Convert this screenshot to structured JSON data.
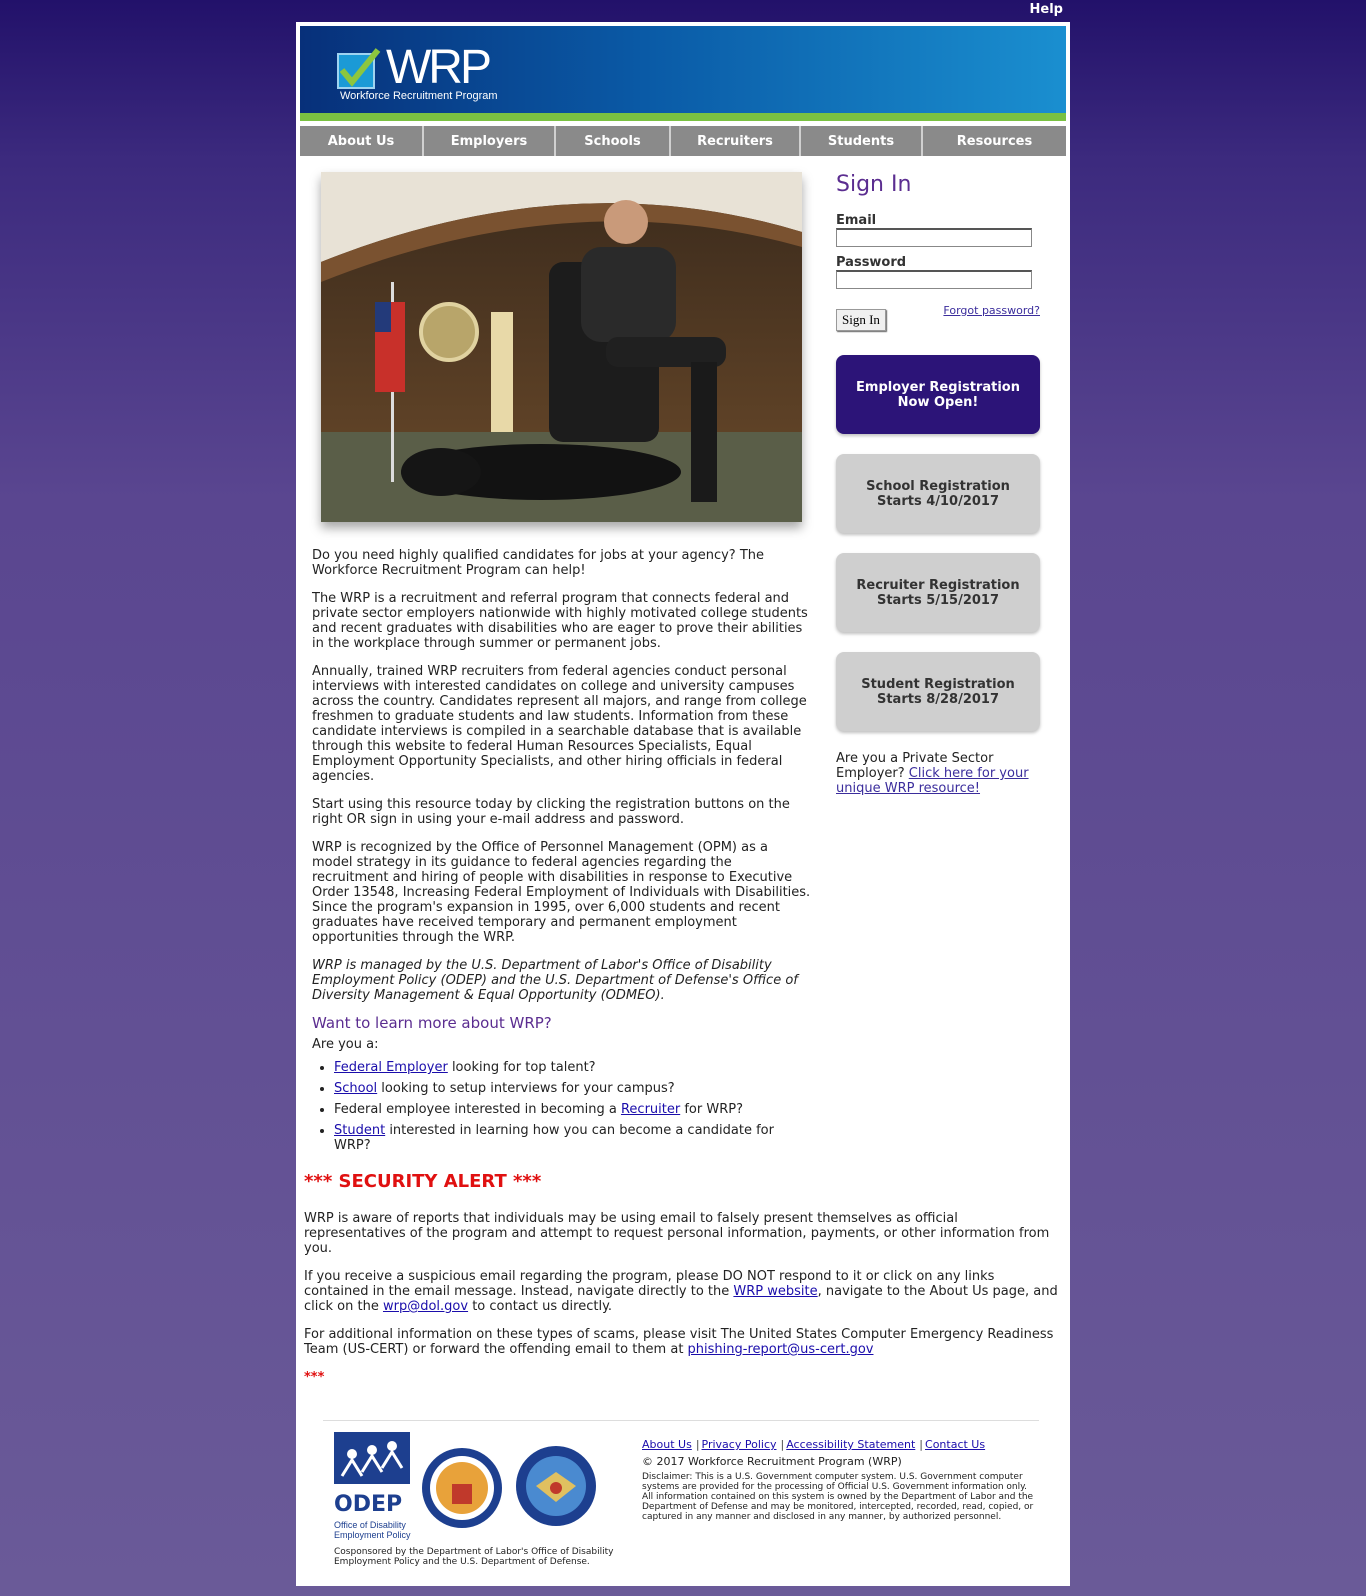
{
  "topbar": {
    "help": "Help"
  },
  "logo": {
    "brand": "WRP",
    "subtitle": "Workforce Recruitment Program"
  },
  "nav": [
    "About Us",
    "Employers",
    "Schools",
    "Recruiters",
    "Students",
    "Resources"
  ],
  "signin": {
    "title": "Sign In",
    "email_label": "Email",
    "password_label": "Password",
    "button": "Sign In",
    "forgot": "Forgot password?"
  },
  "cta": {
    "employer": [
      "Employer Registration",
      "Now Open!"
    ],
    "school": [
      "School Registration",
      "Starts 4/10/2017"
    ],
    "recruiter": [
      "Recruiter Registration",
      "Starts 5/15/2017"
    ],
    "student": [
      "Student Registration",
      "Starts 8/28/2017"
    ]
  },
  "private_sector": {
    "text": "Are you a Private Sector Employer? ",
    "link": "Click here for your unique WRP resource!"
  },
  "main": {
    "p1": "Do you need highly qualified candidates for jobs at your agency? The Workforce Recruitment Program can help!",
    "p2": "The WRP is a recruitment and referral program that connects federal and private sector employers nationwide with highly motivated college students and recent graduates with disabilities who are eager to prove their abilities in the workplace through summer or permanent jobs.",
    "p3": "Annually, trained WRP recruiters from federal agencies conduct personal interviews with interested candidates on college and university campuses across the country. Candidates represent all majors, and range from college freshmen to graduate students and law students. Information from these candidate interviews is compiled in a searchable database that is available through this website to federal Human Resources Specialists, Equal Employment Opportunity Specialists, and other hiring officials in federal agencies.",
    "p4": "Start using this resource today by clicking the registration buttons on the right OR sign in using your e-mail address and password.",
    "p5": "WRP is recognized by the Office of Personnel Management (OPM) as a model strategy in its guidance to federal agencies regarding the recruitment and hiring of people with disabilities in response to Executive Order 13548, Increasing Federal Employment of Individuals with Disabilities. Since the program's expansion in 1995, over 6,000 students and recent graduates have received temporary and permanent employment opportunities through the WRP.",
    "p6": "WRP is managed by the U.S. Department of Labor's Office of Disability Employment Policy (ODEP) and the U.S. Department of Defense's Office of Diversity Management & Equal Opportunity (ODMEO).",
    "learn_heading": "Want to learn more about WRP?",
    "are_you": "Are you a:",
    "list": [
      {
        "pre": "",
        "link": "Federal Employer",
        "post": " looking for top talent?"
      },
      {
        "pre": "",
        "link": "School",
        "post": " looking to setup interviews for your campus?"
      },
      {
        "pre": "Federal employee interested in becoming a ",
        "link": "Recruiter",
        "post": " for WRP?"
      },
      {
        "pre": "",
        "link": "Student",
        "post": " interested in learning how you can become a candidate for WRP?"
      }
    ]
  },
  "alert": {
    "title": "*** SECURITY ALERT ***",
    "p1": "WRP is aware of reports that individuals may be using email to falsely present themselves as official representatives of the program and attempt to request personal information, payments, or other information from you.",
    "p2a": "If you receive a suspicious email regarding the program, please DO NOT respond to it or click on any links contained in the email message. Instead, navigate directly to the ",
    "p2_link": "WRP website",
    "p2b": ", navigate to the About Us page, and click on the ",
    "p2_email": "wrp@dol.gov",
    "p2c": " to contact us directly.",
    "p3a": "For additional information on these types of scams, please visit The United States Computer Emergency Readiness Team (US-CERT) or forward the offending email to them at ",
    "p3_email": "phishing-report@us-cert.gov",
    "end": "***"
  },
  "footer": {
    "odep": "ODEP",
    "odep_sub1": "Office of Disability",
    "odep_sub2": "Employment Policy",
    "cosponsor": "Cosponsored by the Department of Labor's Office of Disability Employment Policy and the U.S. Department of Defense.",
    "links": [
      "About Us",
      "Privacy Policy",
      "Accessibility Statement",
      "Contact Us"
    ],
    "copyright": "© 2017 Workforce Recruitment Program (WRP)",
    "disclaimer": "Disclaimer: This is a U.S. Government computer system. U.S. Government computer systems are provided for the processing of Official U.S. Government information only. All information contained on this system is owned by the Department of Labor and the Department of Defense and may be monitored, intercepted, recorded, read, copied, or captured in any manner and disclosed in any manner, by authorized personnel."
  },
  "colors": {
    "brand_purple": "#5b2d90",
    "cta_dark": "#2c1478",
    "alert_red": "#e01010",
    "nav_grey": "#8a8a8a"
  }
}
